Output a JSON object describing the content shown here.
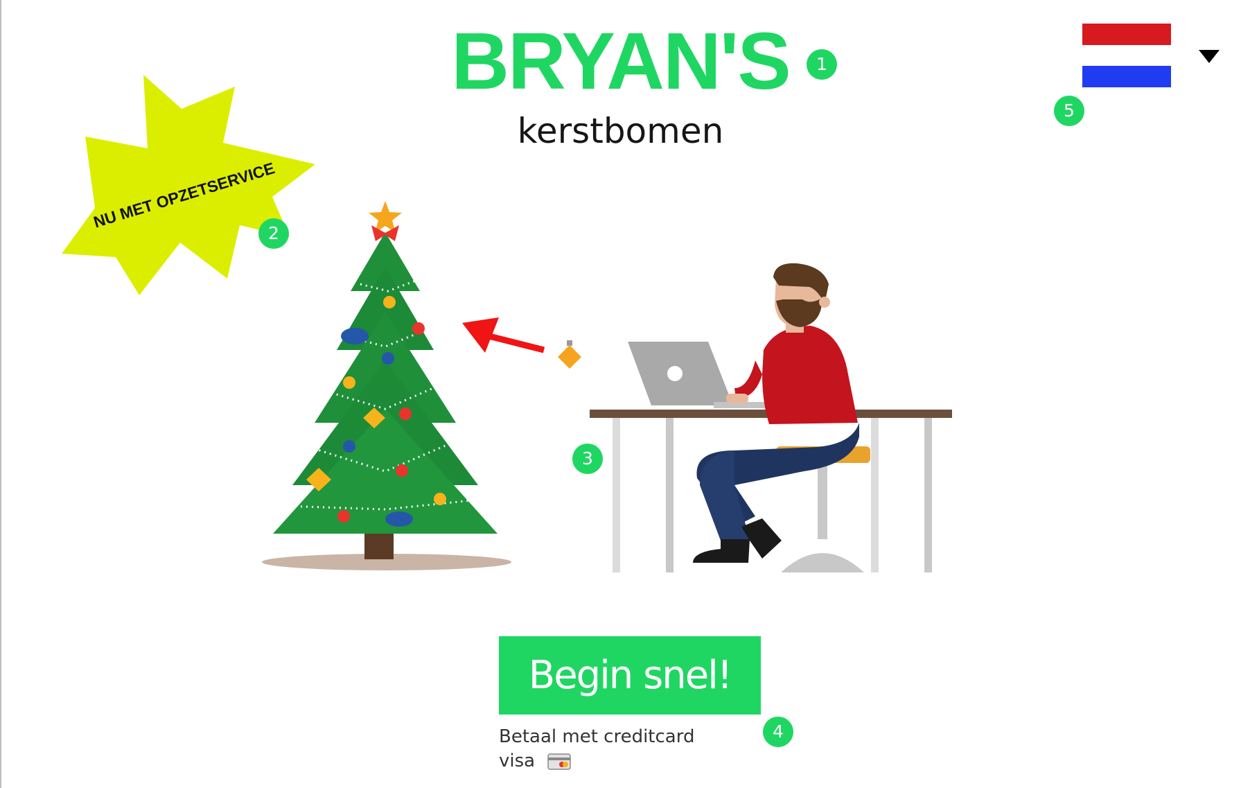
{
  "header": {
    "title": "BRYAN'S",
    "subtitle": "kerstbomen"
  },
  "promo": {
    "badge_text": "NU MET OPZETSERVICE",
    "color": "#dcee00"
  },
  "language": {
    "selected_flag": "netherlands-flag-icon",
    "dropdown_icon": "caret-down-icon"
  },
  "hero": {
    "illustration": "christmas-tree-and-man-at-laptop"
  },
  "cta": {
    "label": "Begin snel!",
    "color": "#20d662"
  },
  "payment": {
    "line1": "Betaal met creditcard",
    "line2": "visa",
    "icon": "credit-card-icon"
  },
  "markers": [
    "1",
    "2",
    "3",
    "4",
    "5"
  ],
  "colors": {
    "brand_green": "#20d662",
    "flag_red": "#d71a1f",
    "flag_blue": "#1f3cf2"
  }
}
